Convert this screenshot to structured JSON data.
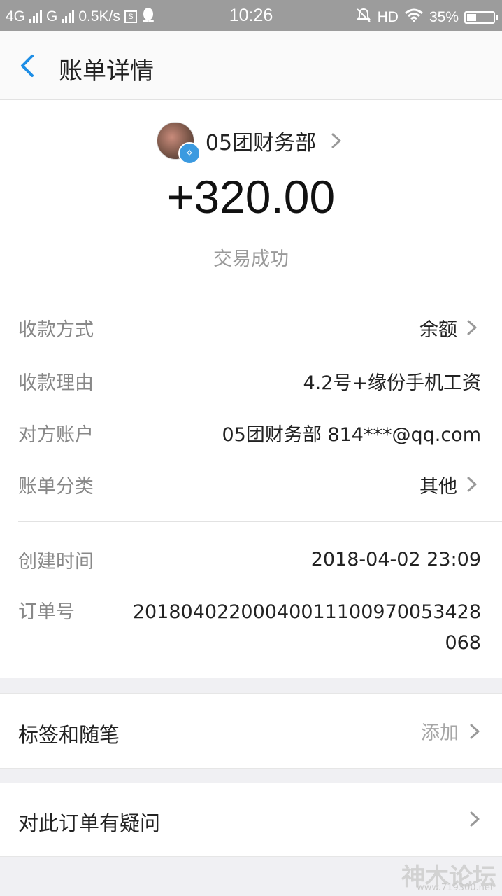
{
  "status_bar": {
    "network_1": "4G",
    "network_2": "G",
    "speed": "0.5K/s",
    "time": "10:26",
    "hd": "HD",
    "battery": "35%",
    "battery_level": 0.35
  },
  "nav": {
    "title": "账单详情"
  },
  "summary": {
    "payee": "05团财务部",
    "amount": "+320.00",
    "status": "交易成功"
  },
  "details": [
    {
      "label": "收款方式",
      "value": "余额"
    },
    {
      "label": "收款理由",
      "value": "4.2号+缘份手机工资"
    },
    {
      "label": "对方账户",
      "value": "05团财务部 814***@qq.com"
    },
    {
      "label": "账单分类",
      "value": "其他"
    }
  ],
  "meta": {
    "created_label": "创建时间",
    "created_value": "2018-04-02 23:09",
    "order_label": "订单号",
    "order_value": "20180402200040011100970053428068"
  },
  "tags": {
    "title": "标签和随笔",
    "action": "添加"
  },
  "question": {
    "title": "对此订单有疑问"
  },
  "watermark": {
    "text": "神木论坛",
    "site": "www.719300.net"
  }
}
